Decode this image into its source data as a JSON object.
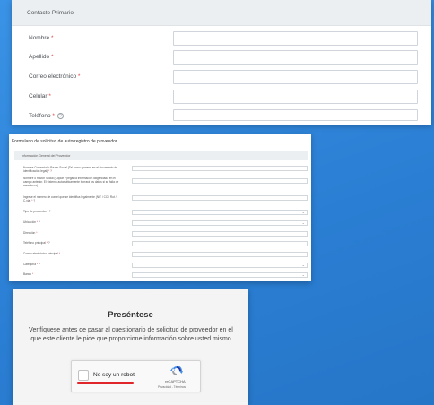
{
  "contact": {
    "header": "Contacto Primario",
    "fields": [
      {
        "label": "Nombre",
        "required": "*"
      },
      {
        "label": "Apellido",
        "required": "*"
      },
      {
        "label": "Correo electrónico",
        "required": "*"
      },
      {
        "label": "Celular",
        "required": "*"
      },
      {
        "label": "Teléfono",
        "required": "*",
        "help": "?"
      }
    ]
  },
  "form": {
    "title": "Formulario de solicitud de autorregistro de proveedor",
    "section": "Información General del Proveedor",
    "fields": [
      {
        "label": "Nombre Comercial o Razón Social (Tal como aparece en el documento de identificación legal)",
        "required": "*",
        "help": "?"
      },
      {
        "label": "Nombre o Razón Social (Copiar y pegar la información diligenciada en el campo anterior. El sistema automáticamente borrará los datos si se falla de caracteres)",
        "required": "*"
      },
      {
        "label": "Ingrese el número de con el que se identifica legalmente (NIT / CC / Rut / C.via)",
        "required": "*",
        "help": "?"
      },
      {
        "label": "Tipo de proveedor",
        "required": "*",
        "help": "?",
        "chevron": "⌄"
      },
      {
        "label": "Ubicación",
        "required": "*",
        "help": "?",
        "chevron": "⌄"
      },
      {
        "label": "Dirección",
        "required": "*"
      },
      {
        "label": "Teléfono principal",
        "required": "*",
        "help": "?"
      },
      {
        "label": "Correo electrónico principal",
        "required": "*"
      },
      {
        "label": "Categoría",
        "required": "*",
        "help": "?",
        "chevron": "⌄"
      },
      {
        "label": "Banco",
        "required": "*",
        "chevron": "⌄"
      }
    ]
  },
  "verify": {
    "heading": "Preséntese",
    "text": "Verifíquese antes de pasar al cuestionario de solicitud de proveedor en el que este cliente le pide que proporcione información sobre usted mismo",
    "captcha_label": "No soy un robot",
    "captcha_brand": "reCAPTCHA",
    "captcha_links": "Privacidad - Términos",
    "underline_color": "#e0262a"
  }
}
